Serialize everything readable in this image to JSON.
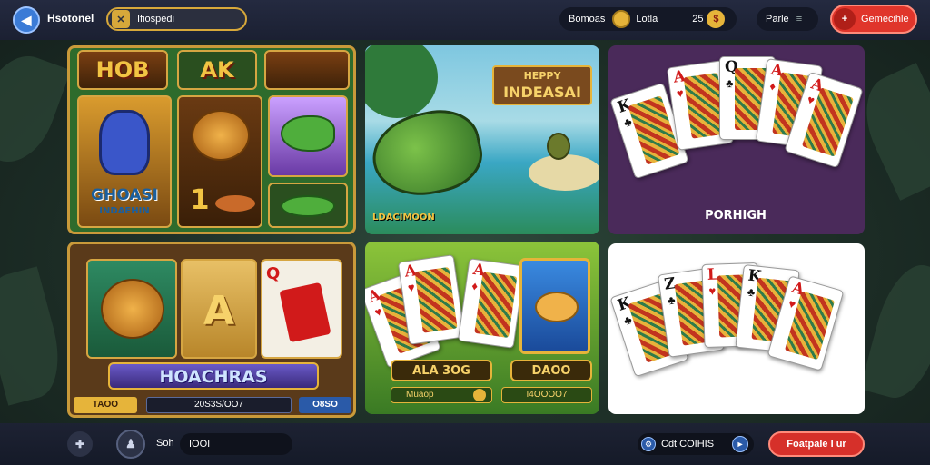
{
  "topbar": {
    "profile_label": "Hsotonel",
    "search_value": "Ifiospedi",
    "bonus_label": "Bomoas",
    "coin_label": "Lotla",
    "coin_count": "25",
    "menu_label": "Parle",
    "action_label": "Gemecihle"
  },
  "tiles": {
    "slots1": {
      "reel_top": [
        "HOB",
        "AK"
      ],
      "title": "GHOASI",
      "subtitle": "INDAEHIN",
      "number": "1"
    },
    "fishing": {
      "banner_line1": "HEPPY",
      "banner_line2": "INDEASAI",
      "caption": "LDACIMOON"
    },
    "poker1": {
      "caption": "PORHIGH",
      "cards": [
        "K",
        "A",
        "Q",
        "A",
        "A"
      ]
    },
    "slots2": {
      "center_letter": "A",
      "card_rank": "Q",
      "title": "HOACHRAS",
      "bar_left": "TAOO",
      "bar_mid": "20S3S/OO7",
      "bar_right": "O8SO"
    },
    "mixed": {
      "label_left": "ALA 3OG",
      "label_right": "DAOO",
      "sub_left": "Muaop",
      "sub_right": "I4OOOO7"
    },
    "poker2": {
      "cards": [
        "K",
        "Z",
        "L",
        "K",
        "A"
      ]
    }
  },
  "bottombar": {
    "search_label": "Soh",
    "search_value": "IOOI",
    "center_label": "Cdt COIHIS",
    "action_label": "Foatpale I ur"
  },
  "colors": {
    "accent_red": "#e0352b",
    "gold": "#e6b43a",
    "topbar_bg": "#242a40"
  },
  "icons": [
    "back-icon",
    "close-icon",
    "coin-icon",
    "gift-icon",
    "plus-icon",
    "move-icon",
    "person-icon",
    "gear-icon",
    "arrow-icon"
  ]
}
